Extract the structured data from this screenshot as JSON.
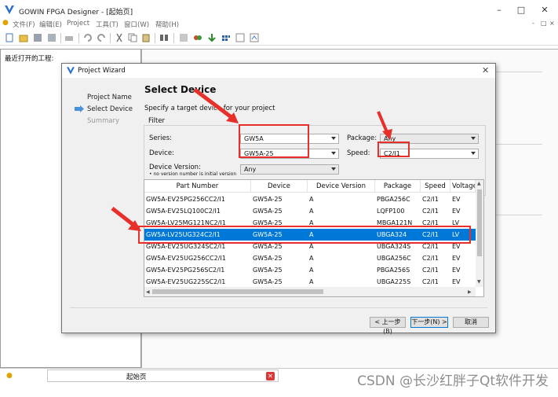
{
  "app": {
    "title": "GOWIN FPGA Designer - [起始页]",
    "menus": [
      "文件(F)",
      "编辑(E)",
      "Project",
      "工具(T)",
      "窗口(W)",
      "帮助(H)"
    ],
    "mdi_buttons": [
      "-",
      "□",
      "×"
    ]
  },
  "left_panel": {
    "title": "最近打开的工程:"
  },
  "bottom": {
    "tab_label": "起始页",
    "watermark": "CSDN @长沙红胖子Qt软件开发"
  },
  "dialog": {
    "title": "Project Wizard",
    "steps": [
      "Project Name",
      "Select Device",
      "Summary"
    ],
    "heading": "Select Device",
    "subtext": "Specify a target device for your project",
    "filter_label": "Filter",
    "series_label": "Series:",
    "series_value": "GW5A",
    "device_label": "Device:",
    "device_value": "GW5A-25",
    "device_version_label": "Device Version:",
    "device_version_note": "no version number is initial version",
    "device_version_value": "Any",
    "package_label": "Package:",
    "package_value": "Any",
    "speed_label": "Speed:",
    "speed_value": "C2/I1",
    "columns": [
      "Part Number",
      "Device",
      "Device Version",
      "Package",
      "Speed",
      "Voltage"
    ],
    "rows": [
      [
        "GW5A-EV25PG256CC2/I1",
        "GW5A-25",
        "A",
        "PBGA256C",
        "C2/I1",
        "EV"
      ],
      [
        "GW5A-EV25LQ100C2/I1",
        "GW5A-25",
        "A",
        "LQFP100",
        "C2/I1",
        "EV"
      ],
      [
        "GW5A-LV25MG121NC2/I1",
        "GW5A-25",
        "A",
        "MBGA121N",
        "C2/I1",
        "LV"
      ],
      [
        "GW5A-LV25UG324C2/I1",
        "GW5A-25",
        "A",
        "UBGA324",
        "C2/I1",
        "LV"
      ],
      [
        "GW5A-EV25UG324SC2/I1",
        "GW5A-25",
        "A",
        "UBGA324S",
        "C2/I1",
        "EV"
      ],
      [
        "GW5A-EV25UG256CC2/I1",
        "GW5A-25",
        "A",
        "UBGA256C",
        "C2/I1",
        "EV"
      ],
      [
        "GW5A-EV25PG256SC2/I1",
        "GW5A-25",
        "A",
        "PBGA256S",
        "C2/I1",
        "EV"
      ],
      [
        "GW5A-EV25UG225SC2/I1",
        "GW5A-25",
        "A",
        "UBGA225S",
        "C2/I1",
        "EV"
      ]
    ],
    "selected_row": 3,
    "buttons": {
      "back": "< 上一步(B)",
      "next": "下一步(N) >",
      "cancel": "取消"
    }
  },
  "colors": {
    "selection": "#0078d7",
    "annotation": "#e8302a",
    "close_tab": "#d83a3a"
  }
}
